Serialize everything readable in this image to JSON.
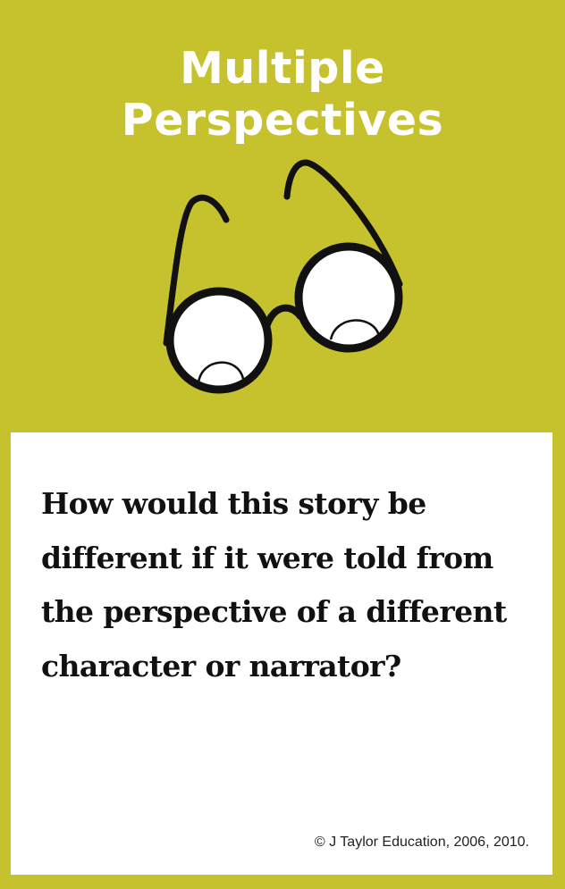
{
  "card": {
    "title_lines": [
      "Multiple",
      "Perspectives"
    ],
    "icon": "glasses-icon",
    "question": "How would this story be different if it were told from the perspective of a different character or narrator?",
    "copyright": "© J Taylor Education, 2006, 2010."
  },
  "colors": {
    "background": "#c6c22e",
    "panel": "#ffffff",
    "title_text": "#ffffff",
    "body_text": "#111111"
  }
}
